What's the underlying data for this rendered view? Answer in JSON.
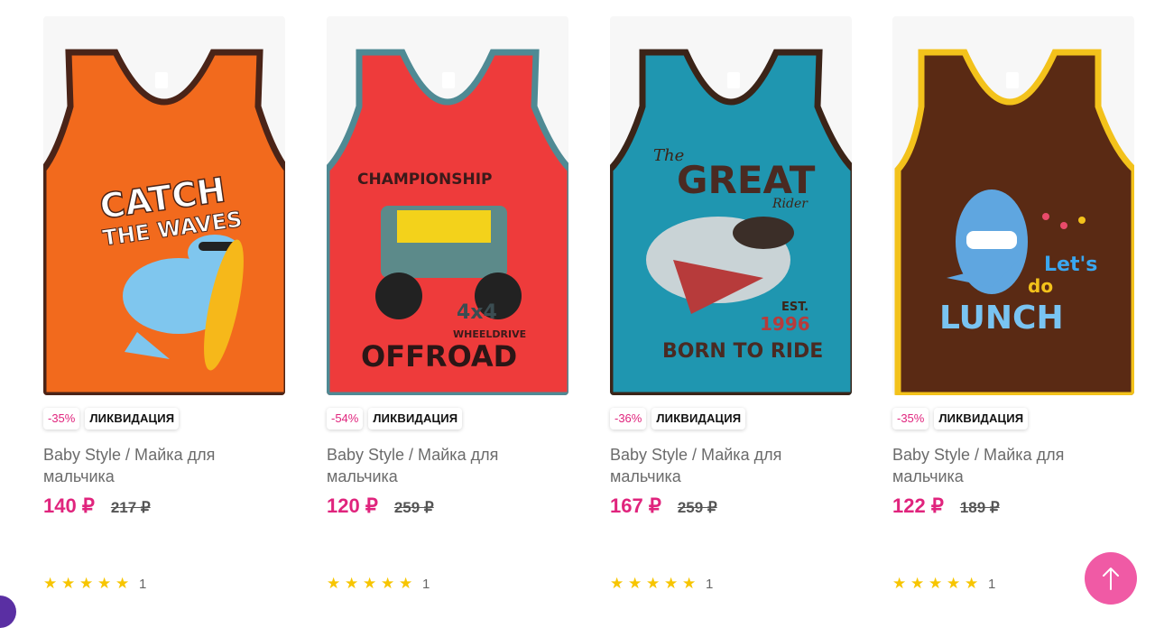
{
  "products": [
    {
      "discount": "-35%",
      "sale_label": "ЛИКВИДАЦИЯ",
      "title": "Baby Style / Майка для мальчика",
      "price": "140 ₽",
      "old_price": "217 ₽",
      "stars": "★★★★★",
      "rating_count": "1",
      "image": {
        "name": "orange-tank-top-dino-image",
        "body_color": "#f26a1d",
        "trim_color": "#4a2418",
        "print": [
          "CATCH",
          "THE WAVES"
        ]
      }
    },
    {
      "discount": "-54%",
      "sale_label": "ЛИКВИДАЦИЯ",
      "title": "Baby Style / Майка для мальчика",
      "price": "120 ₽",
      "old_price": "259 ₽",
      "stars": "★★★★★",
      "rating_count": "1",
      "image": {
        "name": "red-tank-top-offroad-image",
        "body_color": "#ee3b3b",
        "trim_color": "#4f8a94",
        "print": [
          "CHAMPIONSHIP",
          "4x4",
          "WHEELDRIVE",
          "OFFROAD"
        ]
      }
    },
    {
      "discount": "-36%",
      "sale_label": "ЛИКВИДАЦИЯ",
      "title": "Baby Style / Майка для мальчика",
      "price": "167 ₽",
      "old_price": "259 ₽",
      "stars": "★★★★★",
      "rating_count": "1",
      "image": {
        "name": "teal-tank-top-shark-image",
        "body_color": "#1f96b0",
        "trim_color": "#3b2418",
        "print": [
          "The",
          "GREAT",
          "Rider",
          "EST.",
          "1996",
          "BORN TO RIDE"
        ]
      }
    },
    {
      "discount": "-35%",
      "sale_label": "ЛИКВИДАЦИЯ",
      "title": "Baby Style / Майка для мальчика",
      "price": "122 ₽",
      "old_price": "189 ₽",
      "stars": "★★★★★",
      "rating_count": "1",
      "image": {
        "name": "brown-tank-top-shark-lunch-image",
        "body_color": "#5a2a14",
        "trim_color": "#f3c21b",
        "print": [
          "Let's",
          "do",
          "LUNCH"
        ]
      }
    }
  ],
  "colors": {
    "accent": "#e0247d",
    "star": "#f7c500",
    "scroll_button": "#f05aa5"
  },
  "icons": {
    "scroll_top": "arrow-up-icon",
    "star": "star-icon"
  }
}
